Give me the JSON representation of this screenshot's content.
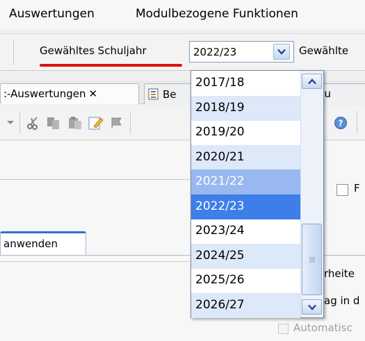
{
  "menu": {
    "items": [
      {
        "label": "Auswertungen"
      },
      {
        "label": "Modulbezogene Funktionen"
      }
    ]
  },
  "toolbar": {
    "year_label": "Gewähltes Schuljahr",
    "year_value": "2022/23",
    "other_label": "Gewählte"
  },
  "tabs": {
    "auswertungen": ":-Auswertungen",
    "close_glyph": "✕",
    "be": "Be",
    "verwaltung": "waltu"
  },
  "dropdown": {
    "items": [
      {
        "label": "2017/18",
        "state": "normal"
      },
      {
        "label": "2018/19",
        "state": "alt"
      },
      {
        "label": "2019/20",
        "state": "normal"
      },
      {
        "label": "2020/21",
        "state": "alt"
      },
      {
        "label": "2021/22",
        "state": "hover"
      },
      {
        "label": "2022/23",
        "state": "selected"
      },
      {
        "label": "2023/24",
        "state": "normal"
      },
      {
        "label": "2024/25",
        "state": "alt"
      },
      {
        "label": "2025/26",
        "state": "normal"
      },
      {
        "label": "2026/27",
        "state": "alt"
      }
    ]
  },
  "content": {
    "checkbox_f_label": "F",
    "subtab_label": "anwenden",
    "text_arbeiten": "rheite",
    "text_tragin": "ag in d",
    "text_auto": "Automatisc"
  },
  "icons": {
    "combo_arrow": "chevron-down-icon",
    "scroll_up": "chevron-up-icon",
    "scroll_down": "chevron-down-icon",
    "scissors": "scissors-icon",
    "copy": "copy-icon",
    "paste": "paste-icon",
    "edit": "edit-icon",
    "help": "help-icon"
  },
  "colors": {
    "underline": "#e01010",
    "selected": "#3d7ee8",
    "hover": "#99b8f0",
    "alt_row": "#dde8f8"
  }
}
